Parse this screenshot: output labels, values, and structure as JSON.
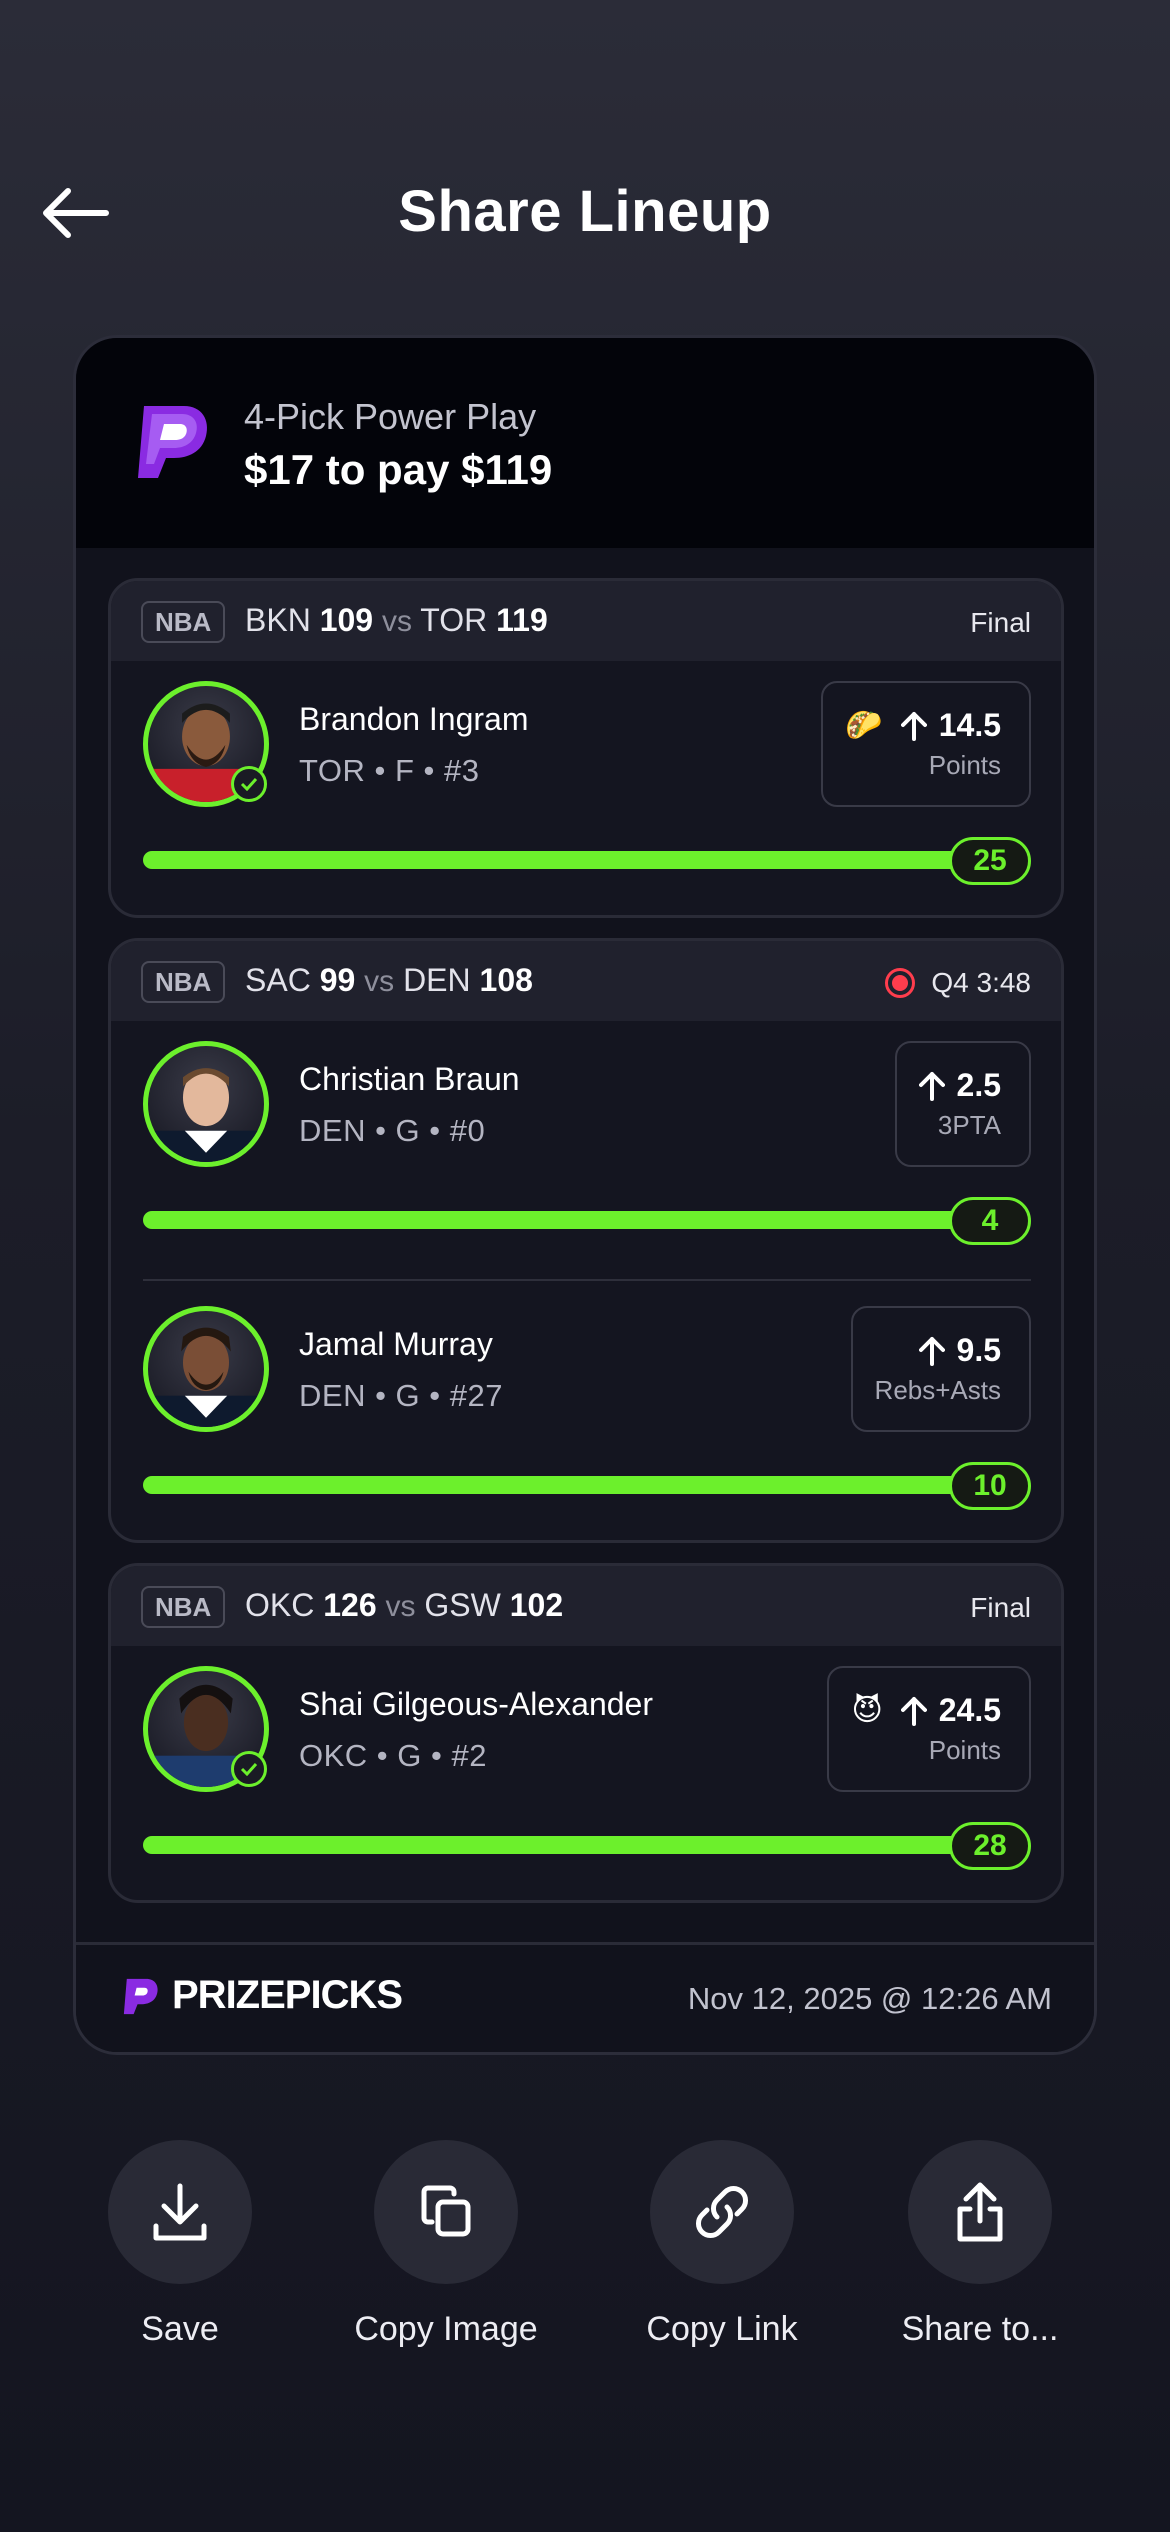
{
  "header": {
    "title": "Share Lineup"
  },
  "lineup": {
    "play_type": "4-Pick Power Play",
    "amount": "$17 to pay $119"
  },
  "games": [
    {
      "league": "NBA",
      "away_team": "BKN",
      "away_score": "109",
      "vs": "vs",
      "home_team": "TOR",
      "home_score": "119",
      "status": "Final",
      "live": false,
      "picks": [
        {
          "name": "Brandon Ingram",
          "meta": "TOR • F • #3",
          "emoji": "🌮",
          "line": "14.5",
          "stat": "Points",
          "result": "25",
          "progress": 1.0,
          "checked": true
        }
      ]
    },
    {
      "league": "NBA",
      "away_team": "SAC",
      "away_score": "99",
      "vs": "vs",
      "home_team": "DEN",
      "home_score": "108",
      "status": "Q4 3:48",
      "live": true,
      "picks": [
        {
          "name": "Christian Braun",
          "meta": "DEN • G • #0",
          "line": "2.5",
          "stat": "3PTA",
          "result": "4",
          "progress": 1.0,
          "checked": false
        },
        {
          "name": "Jamal Murray",
          "meta": "DEN • G • #27",
          "line": "9.5",
          "stat": "Rebs+Asts",
          "result": "10",
          "progress": 1.0,
          "checked": false
        }
      ]
    },
    {
      "league": "NBA",
      "away_team": "OKC",
      "away_score": "126",
      "vs": "vs",
      "home_team": "GSW",
      "home_score": "102",
      "status": "Final",
      "live": false,
      "picks": [
        {
          "name": "Shai Gilgeous-Alexander",
          "meta": "OKC • G • #2",
          "emoji": "😈",
          "line": "24.5",
          "stat": "Points",
          "result": "28",
          "progress": 1.0,
          "checked": true
        }
      ]
    }
  ],
  "footer": {
    "brand": "PRIZEPICKS",
    "date": "Nov 12, 2025 @ 12:26 AM"
  },
  "actions": [
    {
      "label": "Save",
      "icon": "download-icon"
    },
    {
      "label": "Copy Image",
      "icon": "copy-icon"
    },
    {
      "label": "Copy Link",
      "icon": "link-icon"
    },
    {
      "label": "Share to...",
      "icon": "share-icon"
    }
  ],
  "colors": {
    "accent_green": "#6cf02c",
    "brand_purple": "#8a2be2",
    "live_red": "#ff3d4d"
  }
}
